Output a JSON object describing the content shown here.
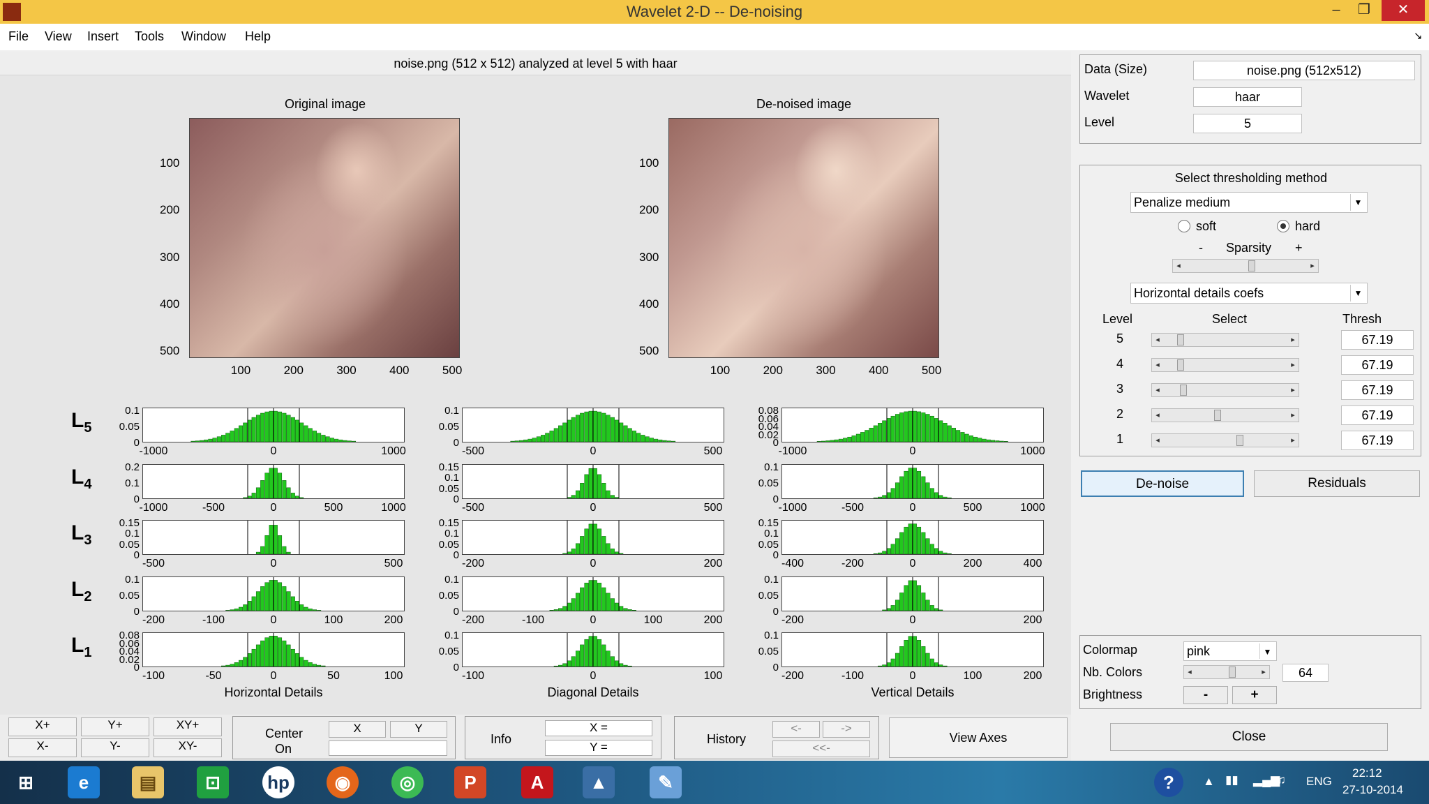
{
  "window": {
    "title": "Wavelet 2-D  --  De-noising",
    "controls": {
      "minimize": "–",
      "restore": "❐",
      "close": "✕"
    },
    "menu": [
      "File",
      "View",
      "Insert",
      "Tools",
      "Window",
      "Help"
    ],
    "corner_glyph": "↘"
  },
  "info_bar": "noise.png (512 x 512) analyzed at level 5 with haar",
  "original_image": {
    "title": "Original image",
    "y_ticks": [
      "100",
      "200",
      "300",
      "400",
      "500"
    ],
    "x_ticks": [
      "100",
      "200",
      "300",
      "400",
      "500"
    ]
  },
  "denoised_image": {
    "title": "De-noised image",
    "y_ticks": [
      "100",
      "200",
      "300",
      "400",
      "500"
    ],
    "x_ticks": [
      "100",
      "200",
      "300",
      "400",
      "500"
    ]
  },
  "histograms": {
    "level_labels": [
      {
        "L": "L",
        "n": "5"
      },
      {
        "L": "L",
        "n": "4"
      },
      {
        "L": "L",
        "n": "3"
      },
      {
        "L": "L",
        "n": "2"
      },
      {
        "L": "L",
        "n": "1"
      }
    ],
    "column_labels": [
      "Horizontal Details",
      "Diagonal Details",
      "Vertical Details"
    ],
    "rows": [
      {
        "cols": [
          {
            "yticks": [
              "0.1",
              "0.05",
              "0"
            ],
            "xticks": [
              "-1000",
              "0",
              "1000"
            ],
            "spread": 0.22
          },
          {
            "yticks": [
              "0.1",
              "0.05",
              "0"
            ],
            "xticks": [
              "-500",
              "0",
              "500"
            ],
            "spread": 0.22
          },
          {
            "yticks": [
              "0.08",
              "0.06",
              "0.04",
              "0.02",
              "0"
            ],
            "xticks": [
              "-1000",
              "0",
              "1000"
            ],
            "spread": 0.25
          }
        ]
      },
      {
        "cols": [
          {
            "yticks": [
              "0.2",
              "0.1",
              "0"
            ],
            "xticks": [
              "-1000",
              "-500",
              "0",
              "500",
              "1000"
            ],
            "spread": 0.08
          },
          {
            "yticks": [
              "0.15",
              "0.1",
              "0.05",
              "0"
            ],
            "xticks": [
              "-500",
              "0",
              "500"
            ],
            "spread": 0.07
          },
          {
            "yticks": [
              "0.1",
              "0.05",
              "0"
            ],
            "xticks": [
              "-1000",
              "-500",
              "0",
              "500",
              "1000"
            ],
            "spread": 0.1
          }
        ]
      },
      {
        "cols": [
          {
            "yticks": [
              "0.15",
              "0.1",
              "0.05",
              "0"
            ],
            "xticks": [
              "-500",
              "0",
              "500"
            ],
            "spread": 0.05
          },
          {
            "yticks": [
              "0.15",
              "0.1",
              "0.05",
              "0"
            ],
            "xticks": [
              "-200",
              "0",
              "200"
            ],
            "spread": 0.08
          },
          {
            "yticks": [
              "0.15",
              "0.1",
              "0.05",
              "0"
            ],
            "xticks": [
              "-400",
              "-200",
              "0",
              "200",
              "400"
            ],
            "spread": 0.1
          }
        ]
      },
      {
        "cols": [
          {
            "yticks": [
              "0.1",
              "0.05",
              "0"
            ],
            "xticks": [
              "-200",
              "-100",
              "0",
              "100",
              "200"
            ],
            "spread": 0.12
          },
          {
            "yticks": [
              "0.1",
              "0.05",
              "0"
            ],
            "xticks": [
              "-200",
              "-100",
              "0",
              "100",
              "200"
            ],
            "spread": 0.11
          },
          {
            "yticks": [
              "0.1",
              "0.05",
              "0"
            ],
            "xticks": [
              "-200",
              "0",
              "200"
            ],
            "spread": 0.08
          }
        ]
      },
      {
        "cols": [
          {
            "yticks": [
              "0.08",
              "0.06",
              "0.04",
              "0.02",
              "0"
            ],
            "xticks": [
              "-100",
              "-50",
              "0",
              "50",
              "100"
            ],
            "spread": 0.14
          },
          {
            "yticks": [
              "0.1",
              "0.05",
              "0"
            ],
            "xticks": [
              "-100",
              "0",
              "100"
            ],
            "spread": 0.1
          },
          {
            "yticks": [
              "0.1",
              "0.05",
              "0"
            ],
            "xticks": [
              "-200",
              "-100",
              "0",
              "100",
              "200"
            ],
            "spread": 0.09
          }
        ]
      }
    ],
    "bar_color": "#22c81e"
  },
  "bottom": {
    "axes_buttons": [
      "X+",
      "Y+",
      "XY+",
      "X-",
      "Y-",
      "XY-"
    ],
    "center_label_1": "Center",
    "center_label_2": "On",
    "center_x": "X",
    "center_y": "Y",
    "center_value": "",
    "info_label": "Info",
    "info_x": "X =",
    "info_y": "Y =",
    "history_label": "History",
    "history_back": "<-",
    "history_forward": "->",
    "history_first": "<<-",
    "view_axes": "View Axes"
  },
  "right": {
    "data_label": "Data  (Size)",
    "data_value": "noise.png  (512x512)",
    "wavelet_label": "Wavelet",
    "wavelet_value": "haar",
    "level_label": "Level",
    "level_value": "5",
    "threshold_title": "Select thresholding method",
    "method": "Penalize medium",
    "soft_label": "soft",
    "hard_label": "hard",
    "hard_selected": true,
    "sparsity_minus": "-",
    "sparsity_label": "Sparsity",
    "sparsity_plus": "+",
    "sparsity_fraction": 0.55,
    "coefs_select": "Horizontal details coefs",
    "table_headers": {
      "level": "Level",
      "select": "Select",
      "thresh": "Thresh"
    },
    "levels": [
      {
        "level": "5",
        "thresh": "67.19",
        "pos": 0.12
      },
      {
        "level": "4",
        "thresh": "67.19",
        "pos": 0.12
      },
      {
        "level": "3",
        "thresh": "67.19",
        "pos": 0.14
      },
      {
        "level": "2",
        "thresh": "67.19",
        "pos": 0.43
      },
      {
        "level": "1",
        "thresh": "67.19",
        "pos": 0.62
      }
    ],
    "denoise_button": "De-noise",
    "residuals_button": "Residuals",
    "colormap_label": "Colormap",
    "colormap_value": "pink",
    "nb_colors_label": "Nb. Colors",
    "nb_colors_value": "64",
    "nb_colors_fraction": 0.58,
    "brightness_label": "Brightness",
    "brightness_minus": "-",
    "brightness_plus": "+",
    "close_button": "Close"
  },
  "taskbar": {
    "icons": [
      "windows-start",
      "internet-explorer",
      "file-explorer",
      "store",
      "hp",
      "firefox",
      "chrome",
      "powerpoint",
      "acrobat",
      "matlab",
      "paint"
    ],
    "tray_lang": "ENG",
    "time": "22:12",
    "date": "27-10-2014"
  }
}
